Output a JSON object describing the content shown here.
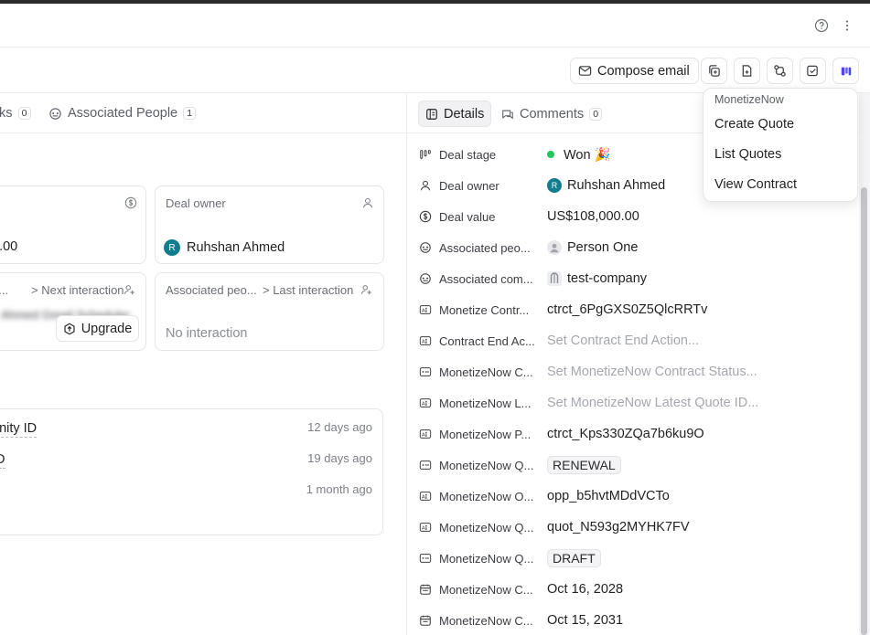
{
  "left": {
    "tabs": [
      {
        "label": "ks",
        "count": "0"
      },
      {
        "label": "Associated People",
        "count": "1"
      }
    ],
    "cards": {
      "value_partial": "0.00",
      "deal_owner_label": "Deal owner",
      "deal_owner_name": "Ruhshan Ahmed",
      "deal_owner_initial": "R",
      "next_interaction_prefix": "e...",
      "next_interaction_label": "> Next interaction",
      "assoc_people_label": "Associated peo...",
      "last_interaction_label": "> Last interaction",
      "no_interaction": "No interaction",
      "blurred_text": "Ahmed Gmail Scheduler"
    },
    "upgrade_label": "Upgrade",
    "activity": [
      {
        "title": "unity ID",
        "time": "12 days ago"
      },
      {
        "title": "ID",
        "time": "19 days ago"
      },
      {
        "title": "",
        "time": "1 month ago"
      }
    ]
  },
  "toolbar": {
    "compose_label": "Compose email"
  },
  "right": {
    "tabs": [
      {
        "label": "Details",
        "count": ""
      },
      {
        "label": "Comments",
        "count": "0"
      }
    ],
    "fields": [
      {
        "label": "Deal stage",
        "value": "Won 🎉",
        "kind": "stage",
        "icon": "stage-icon"
      },
      {
        "label": "Deal owner",
        "value": "Ruhshan Ahmed",
        "kind": "avatar",
        "icon": "person-icon"
      },
      {
        "label": "Deal value",
        "value": "US$108,000.00",
        "kind": "text",
        "icon": "currency-icon"
      },
      {
        "label": "Associated peo...",
        "value": "Person One",
        "kind": "person",
        "icon": "link-people-icon"
      },
      {
        "label": "Associated com...",
        "value": "test-company",
        "kind": "company",
        "icon": "link-company-icon"
      },
      {
        "label": "Monetize Contr...",
        "value": "ctrct_6PgGXS0Z5QlcRRTv",
        "kind": "text",
        "icon": "text-field-icon"
      },
      {
        "label": "Contract End Ac...",
        "value": "Set Contract End Action...",
        "kind": "placeholder",
        "icon": "text-field-icon"
      },
      {
        "label": "MonetizeNow C...",
        "value": "Set MonetizeNow Contract Status...",
        "kind": "placeholder",
        "icon": "select-field-icon"
      },
      {
        "label": "MonetizeNow L...",
        "value": "Set MonetizeNow Latest Quote ID...",
        "kind": "placeholder",
        "icon": "text-field-icon"
      },
      {
        "label": "MonetizeNow P...",
        "value": "ctrct_Kps330ZQa7b6ku9O",
        "kind": "text",
        "icon": "text-field-icon"
      },
      {
        "label": "MonetizeNow Q...",
        "value": "RENEWAL",
        "kind": "chip",
        "icon": "select-field-icon"
      },
      {
        "label": "MonetizeNow O...",
        "value": "opp_b5hvtMDdVCTo",
        "kind": "text",
        "icon": "text-field-icon"
      },
      {
        "label": "MonetizeNow Q...",
        "value": "quot_N593g2MYHK7FV",
        "kind": "text",
        "icon": "text-field-icon"
      },
      {
        "label": "MonetizeNow Q...",
        "value": "DRAFT",
        "kind": "chip",
        "icon": "select-field-icon"
      },
      {
        "label": "MonetizeNow C...",
        "value": "Oct 16, 2028",
        "kind": "text",
        "icon": "calendar-icon"
      },
      {
        "label": "MonetizeNow C...",
        "value": "Oct 15, 2031",
        "kind": "text",
        "icon": "calendar-icon"
      }
    ]
  },
  "dropdown": {
    "header": "MonetizeNow",
    "items": [
      "Create Quote",
      "List Quotes",
      "View Contract"
    ]
  },
  "colors": {
    "stage_won": "#22c55e",
    "avatar_bg": "#127d8c",
    "monetize_brand": "#4f46e5"
  }
}
